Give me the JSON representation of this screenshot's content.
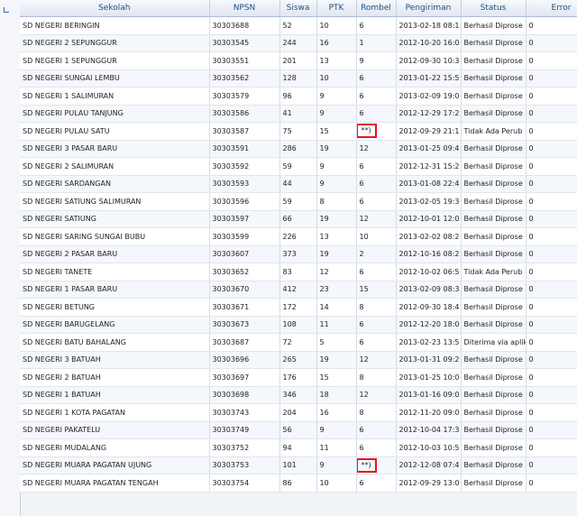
{
  "columns": [
    "Sekolah",
    "NPSN",
    "Siswa",
    "PTK",
    "Rombel",
    "Pengiriman",
    "Status",
    "Error"
  ],
  "rows": [
    {
      "sekolah": "SD NEGERI BERINGIN",
      "npsn": "30303688",
      "siswa": "52",
      "ptk": "10",
      "rombel": "6",
      "pengiriman": "2013-02-18 08:1",
      "status": "Berhasil Diprose",
      "error": "0",
      "highlight": false
    },
    {
      "sekolah": "SD NEGERI 2 SEPUNGGUR",
      "npsn": "30303545",
      "siswa": "244",
      "ptk": "16",
      "rombel": "1",
      "pengiriman": "2012-10-20 16:0",
      "status": "Berhasil Diprose",
      "error": "0",
      "highlight": false
    },
    {
      "sekolah": "SD NEGERI 1 SEPUNGGUR",
      "npsn": "30303551",
      "siswa": "201",
      "ptk": "13",
      "rombel": "9",
      "pengiriman": "2012-09-30 10:3",
      "status": "Berhasil Diprose",
      "error": "0",
      "highlight": false
    },
    {
      "sekolah": "SD NEGERI SUNGAI LEMBU",
      "npsn": "30303562",
      "siswa": "128",
      "ptk": "10",
      "rombel": "6",
      "pengiriman": "2013-01-22 15:5",
      "status": "Berhasil Diprose",
      "error": "0",
      "highlight": false
    },
    {
      "sekolah": "SD NEGERI 1 SALIMURAN",
      "npsn": "30303579",
      "siswa": "96",
      "ptk": "9",
      "rombel": "6",
      "pengiriman": "2013-02-09 19:0",
      "status": "Berhasil Diprose",
      "error": "0",
      "highlight": false
    },
    {
      "sekolah": "SD NEGERI PULAU TANJUNG",
      "npsn": "30303586",
      "siswa": "41",
      "ptk": "9",
      "rombel": "6",
      "pengiriman": "2012-12-29 17:2",
      "status": "Berhasil Diprose",
      "error": "0",
      "highlight": false
    },
    {
      "sekolah": "SD NEGERI PULAU SATU",
      "npsn": "30303587",
      "siswa": "75",
      "ptk": "15",
      "rombel": "**)",
      "pengiriman": "2012-09-29 21:1",
      "status": "Tidak Ada Perub",
      "error": "0",
      "highlight": true
    },
    {
      "sekolah": "SD NEGERI 3 PASAR BARU",
      "npsn": "30303591",
      "siswa": "286",
      "ptk": "19",
      "rombel": "12",
      "pengiriman": "2013-01-25 09:4",
      "status": "Berhasil Diprose",
      "error": "0",
      "highlight": false
    },
    {
      "sekolah": "SD NEGERI 2 SALIMURAN",
      "npsn": "30303592",
      "siswa": "59",
      "ptk": "9",
      "rombel": "6",
      "pengiriman": "2012-12-31 15:2",
      "status": "Berhasil Diprose",
      "error": "0",
      "highlight": false
    },
    {
      "sekolah": "SD NEGERI SARDANGAN",
      "npsn": "30303593",
      "siswa": "44",
      "ptk": "9",
      "rombel": "6",
      "pengiriman": "2013-01-08 22:4",
      "status": "Berhasil Diprose",
      "error": "0",
      "highlight": false
    },
    {
      "sekolah": "SD NEGERI SATIUNG SALIMURAN",
      "npsn": "30303596",
      "siswa": "59",
      "ptk": "8",
      "rombel": "6",
      "pengiriman": "2013-02-05 19:3",
      "status": "Berhasil Diprose",
      "error": "0",
      "highlight": false
    },
    {
      "sekolah": "SD NEGERI SATIUNG",
      "npsn": "30303597",
      "siswa": "66",
      "ptk": "19",
      "rombel": "12",
      "pengiriman": "2012-10-01 12:0",
      "status": "Berhasil Diprose",
      "error": "0",
      "highlight": false
    },
    {
      "sekolah": "SD NEGERI SARING SUNGAI BUBU",
      "npsn": "30303599",
      "siswa": "226",
      "ptk": "13",
      "rombel": "10",
      "pengiriman": "2013-02-02 08:2",
      "status": "Berhasil Diprose",
      "error": "0",
      "highlight": false
    },
    {
      "sekolah": "SD NEGERI 2 PASAR BARU",
      "npsn": "30303607",
      "siswa": "373",
      "ptk": "19",
      "rombel": "2",
      "pengiriman": "2012-10-16 08:2",
      "status": "Berhasil Diprose",
      "error": "0",
      "highlight": false
    },
    {
      "sekolah": "SD NEGERI TANETE",
      "npsn": "30303652",
      "siswa": "83",
      "ptk": "12",
      "rombel": "6",
      "pengiriman": "2012-10-02 06:5",
      "status": "Tidak Ada Perub",
      "error": "0",
      "highlight": false
    },
    {
      "sekolah": "SD NEGERI 1 PASAR BARU",
      "npsn": "30303670",
      "siswa": "412",
      "ptk": "23",
      "rombel": "15",
      "pengiriman": "2013-02-09 08:3",
      "status": "Berhasil Diprose",
      "error": "0",
      "highlight": false
    },
    {
      "sekolah": "SD NEGERI BETUNG",
      "npsn": "30303671",
      "siswa": "172",
      "ptk": "14",
      "rombel": "8",
      "pengiriman": "2012-09-30 18:4",
      "status": "Berhasil Diprose",
      "error": "0",
      "highlight": false
    },
    {
      "sekolah": "SD NEGERI BARUGELANG",
      "npsn": "30303673",
      "siswa": "108",
      "ptk": "11",
      "rombel": "6",
      "pengiriman": "2012-12-20 18:0",
      "status": "Berhasil Diprose",
      "error": "0",
      "highlight": false
    },
    {
      "sekolah": "SD NEGERI BATU BAHALANG",
      "npsn": "30303687",
      "siswa": "72",
      "ptk": "5",
      "rombel": "6",
      "pengiriman": "2013-02-23 13:5",
      "status": "Diterima via aplik",
      "error": "0",
      "highlight": false
    },
    {
      "sekolah": "SD NEGERI 3 BATUAH",
      "npsn": "30303696",
      "siswa": "265",
      "ptk": "19",
      "rombel": "12",
      "pengiriman": "2013-01-31 09:2",
      "status": "Berhasil Diprose",
      "error": "0",
      "highlight": false
    },
    {
      "sekolah": "SD NEGERI 2 BATUAH",
      "npsn": "30303697",
      "siswa": "176",
      "ptk": "15",
      "rombel": "8",
      "pengiriman": "2013-01-25 10:0",
      "status": "Berhasil Diprose",
      "error": "0",
      "highlight": false
    },
    {
      "sekolah": "SD NEGERI 1 BATUAH",
      "npsn": "30303698",
      "siswa": "346",
      "ptk": "18",
      "rombel": "12",
      "pengiriman": "2013-01-16 09:0",
      "status": "Berhasil Diprose",
      "error": "0",
      "highlight": false
    },
    {
      "sekolah": "SD NEGERI 1 KOTA PAGATAN",
      "npsn": "30303743",
      "siswa": "204",
      "ptk": "16",
      "rombel": "8",
      "pengiriman": "2012-11-20 09:0",
      "status": "Berhasil Diprose",
      "error": "0",
      "highlight": false
    },
    {
      "sekolah": "SD NEGERI PAKATELU",
      "npsn": "30303749",
      "siswa": "56",
      "ptk": "9",
      "rombel": "6",
      "pengiriman": "2012-10-04 17:3",
      "status": "Berhasil Diprose",
      "error": "0",
      "highlight": false
    },
    {
      "sekolah": "SD NEGERI MUDALANG",
      "npsn": "30303752",
      "siswa": "94",
      "ptk": "11",
      "rombel": "6",
      "pengiriman": "2012-10-03 10:5",
      "status": "Berhasil Diprose",
      "error": "0",
      "highlight": false
    },
    {
      "sekolah": "SD NEGERI MUARA PAGATAN UJUNG",
      "npsn": "30303753",
      "siswa": "101",
      "ptk": "9",
      "rombel": "**)",
      "pengiriman": "2012-12-08 07:4",
      "status": "Berhasil Diprose",
      "error": "0",
      "highlight": true
    },
    {
      "sekolah": "SD NEGERI MUARA PAGATAN TENGAH",
      "npsn": "30303754",
      "siswa": "86",
      "ptk": "10",
      "rombel": "6",
      "pengiriman": "2012-09-29 13:0",
      "status": "Berhasil Diprose",
      "error": "0",
      "highlight": false
    }
  ],
  "colors": {
    "highlight_border": "#e8141a",
    "header_text": "#1e4e7e"
  }
}
